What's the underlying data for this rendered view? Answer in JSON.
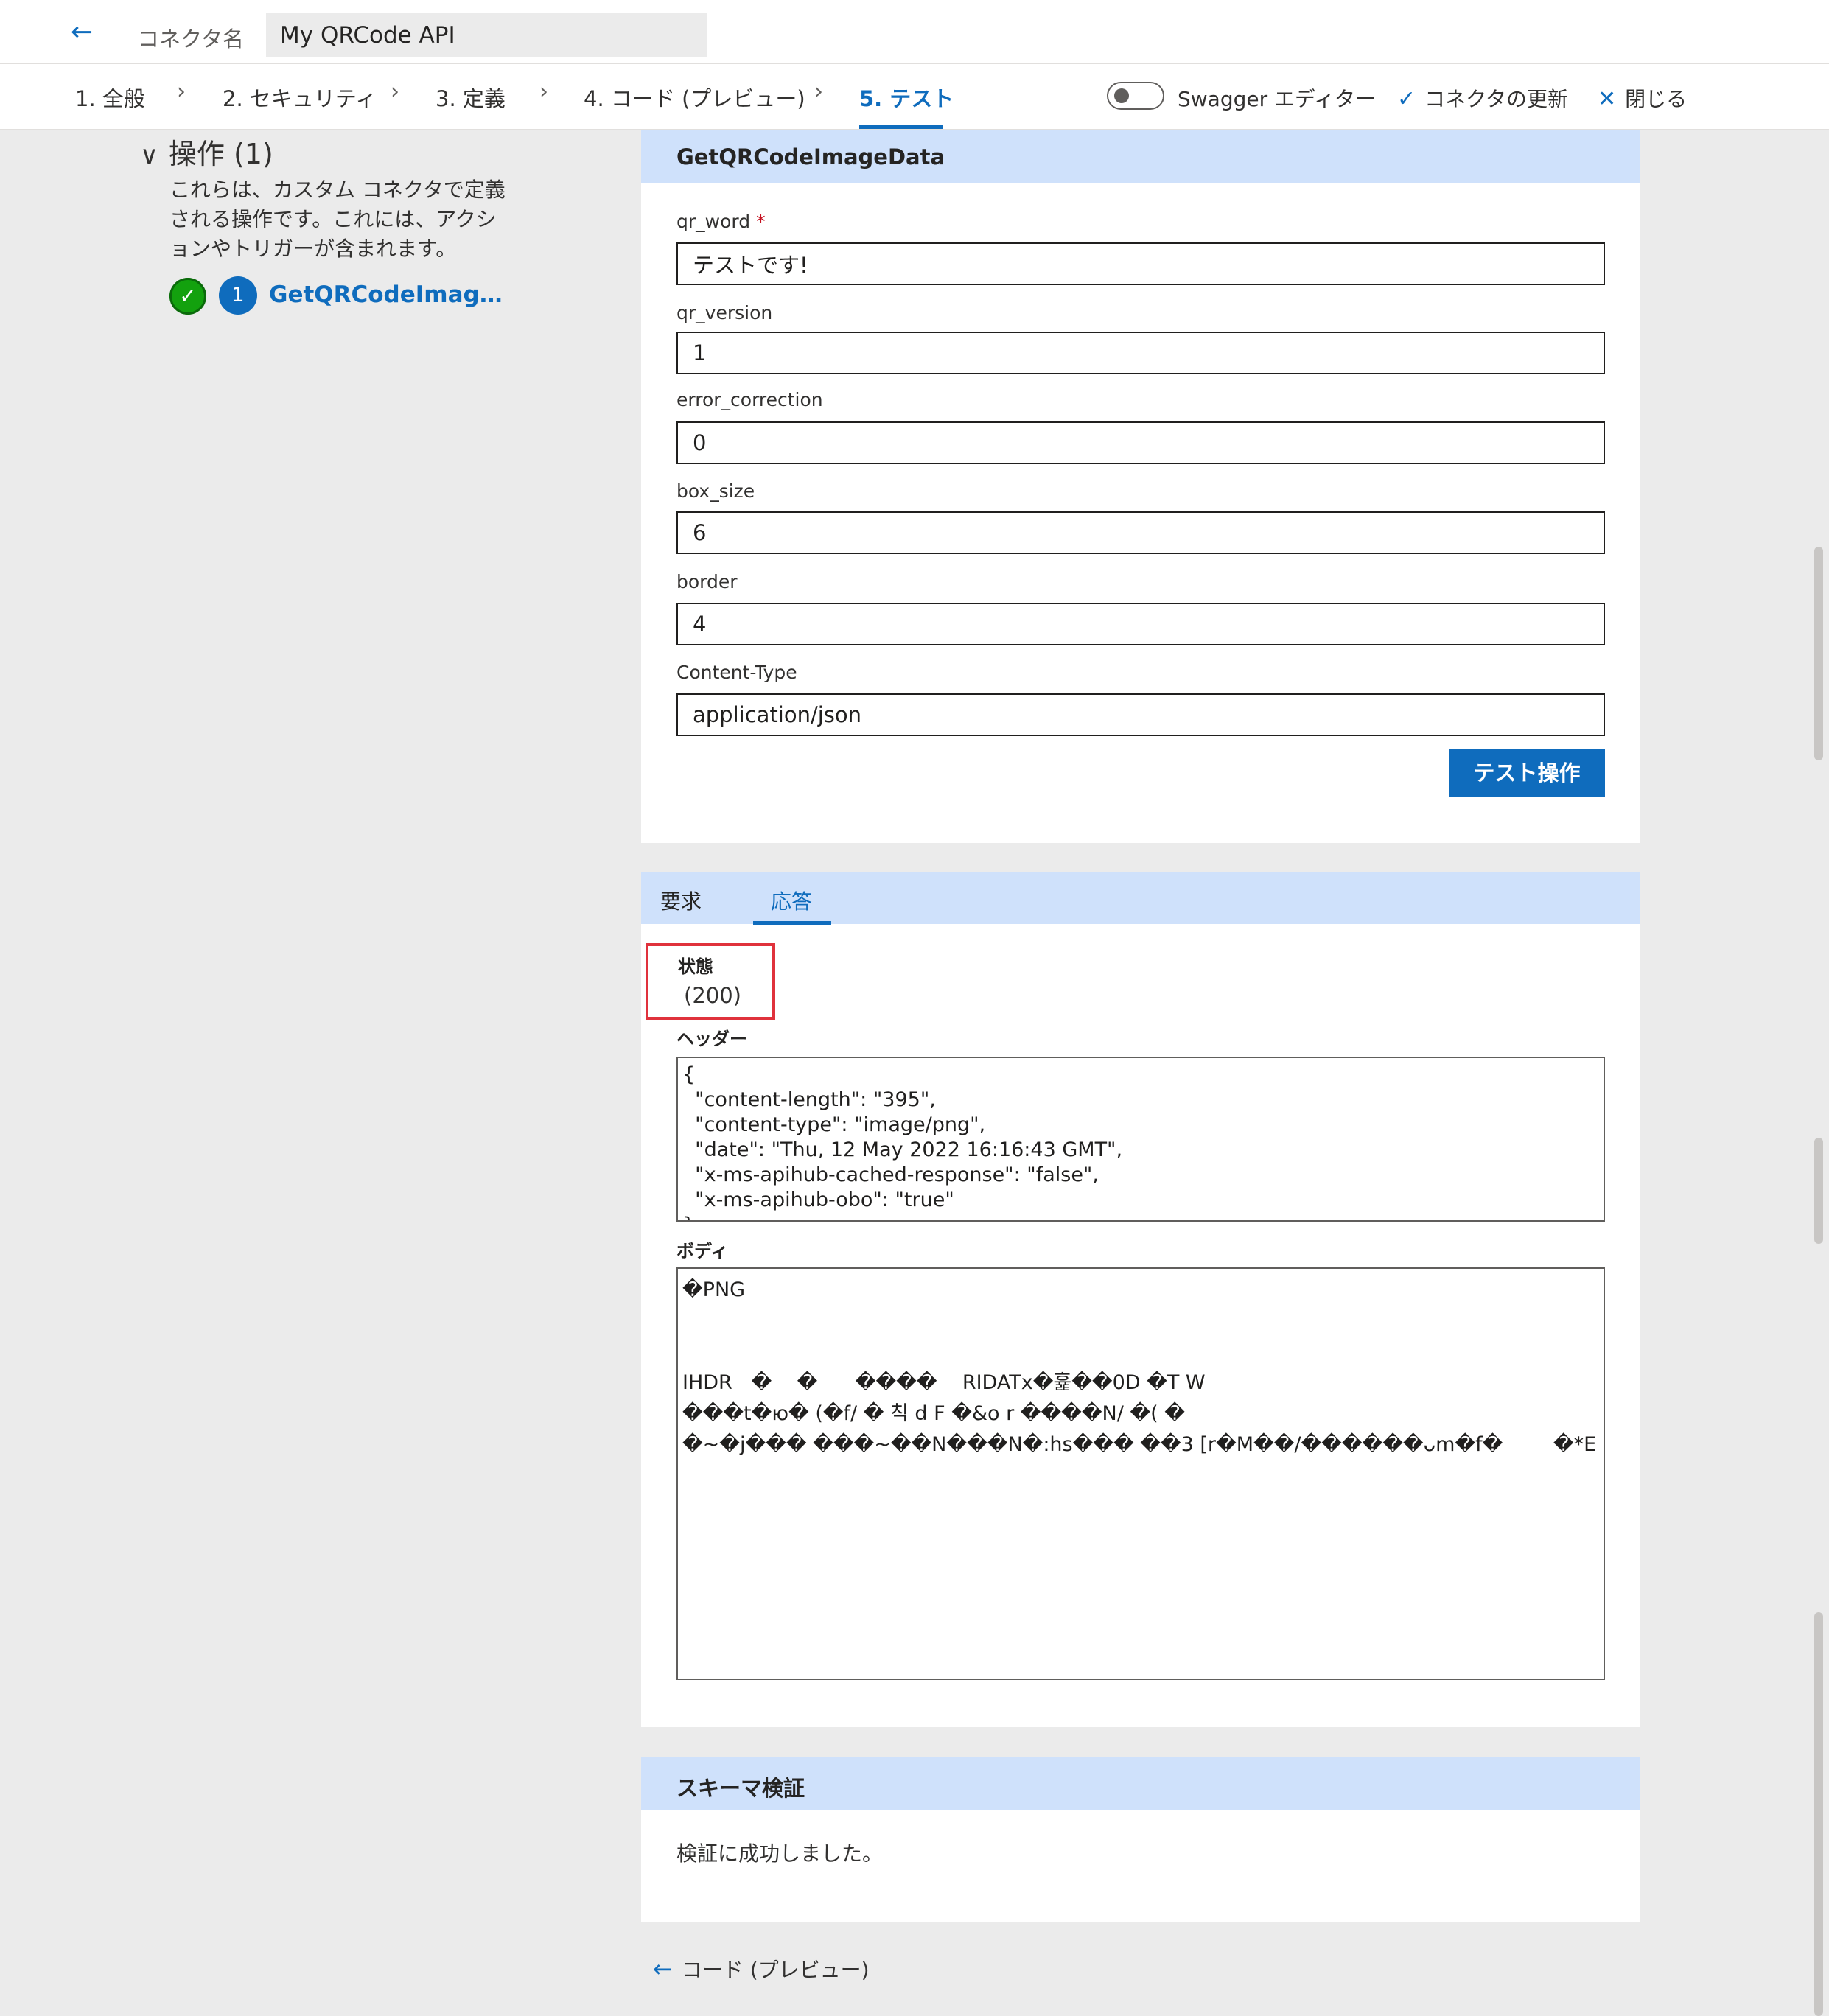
{
  "topbar": {
    "connector_label": "コネクタ名",
    "connector_name": "My QRCode API"
  },
  "steps": [
    {
      "label": "1. 全般"
    },
    {
      "label": "2. セキュリティ"
    },
    {
      "label": "3. 定義"
    },
    {
      "label": "4. コード (プレビュー)"
    },
    {
      "label": "5. テスト"
    }
  ],
  "commands": {
    "swagger_label": "Swagger エディター",
    "update_label": "コネクタの更新",
    "close_label": "閉じる"
  },
  "operations": {
    "heading": "操作 (1)",
    "description": "これらは、カスタム コネクタで定義される操作です。これには、アクションやトリガーが含まれます。",
    "item_number": "1",
    "item_name": "GetQRCodeImag…"
  },
  "test_form": {
    "title": "GetQRCodeImageData",
    "fields": [
      {
        "label": "qr_word",
        "required": true,
        "value": "テストです!"
      },
      {
        "label": "qr_version",
        "required": false,
        "value": "1"
      },
      {
        "label": "error_correction",
        "required": false,
        "value": "0"
      },
      {
        "label": "box_size",
        "required": false,
        "value": "6"
      },
      {
        "label": "border",
        "required": false,
        "value": "4"
      },
      {
        "label": "Content-Type",
        "required": false,
        "value": "application/json"
      }
    ],
    "required_mark": "*",
    "test_button": "テスト操作"
  },
  "response": {
    "tabs": [
      {
        "label": "要求",
        "active": false
      },
      {
        "label": "応答",
        "active": true
      }
    ],
    "status_label": "状態",
    "status_value": "(200)",
    "headers_label": "ヘッダー",
    "headers_text": "{\n  \"content-length\": \"395\",\n  \"content-type\": \"image/png\",\n  \"date\": \"Thu, 12 May 2022 16:16:43 GMT\",\n  \"x-ms-apihub-cached-response\": \"false\",\n  \"x-ms-apihub-obo\": \"true\"\n}",
    "body_label": "ボディ",
    "body_text": "�PNG\n\n\nIHDR   �    �      ����    RIDATx�흁��0D �T W\n���t�ю� (�f/ � 칙 d F �&o r ����N/ �( �\n�~�j��� ���~��N���N�:hs��� ��3 [r�M��/������ᴗm�f�        �*E"
  },
  "schema": {
    "title": "スキーマ検証",
    "message": "検証に成功しました。"
  },
  "footer": {
    "back_link": "コード (プレビュー)"
  },
  "colors": {
    "accent": "#0f6cbd",
    "header_band": "#cfe1fb",
    "success": "#13a10e",
    "highlight_box": "#e0323c",
    "page_bg": "#ebebeb"
  }
}
